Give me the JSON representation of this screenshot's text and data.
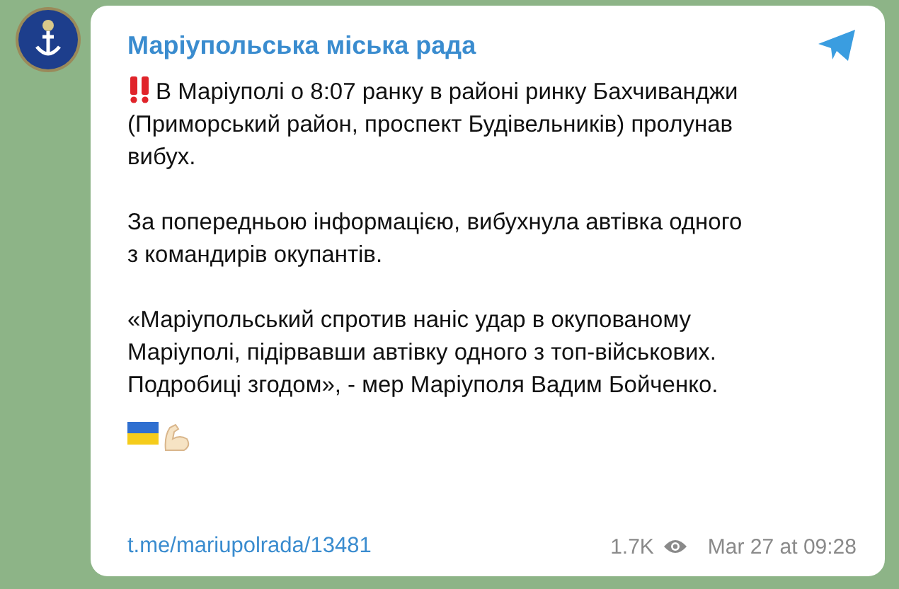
{
  "channel": {
    "name": "Маріупольська міська рада"
  },
  "post": {
    "paragraphs": [
      {
        "text": "В Маріуполі о 8:07 ранку в районі ринку Бахчиванджи (Приморський район, проспект Будівельників) пролунав вибух.",
        "alert": true
      },
      {
        "text": "За попередньою інформацією, вибухнула автівка одного з командирів окупантів.",
        "alert": false
      },
      {
        "text": "«Маріупольський спротив наніс удар в окупованому Маріуполі, підірвавши автівку одного з топ-військових. Подробиці згодом», - мер Маріуполя Вадим Бойченко.",
        "alert": false
      }
    ],
    "link": "t.me/mariupolrada/13481",
    "views": "1.7K",
    "date": "Mar 27 at 09:28"
  }
}
